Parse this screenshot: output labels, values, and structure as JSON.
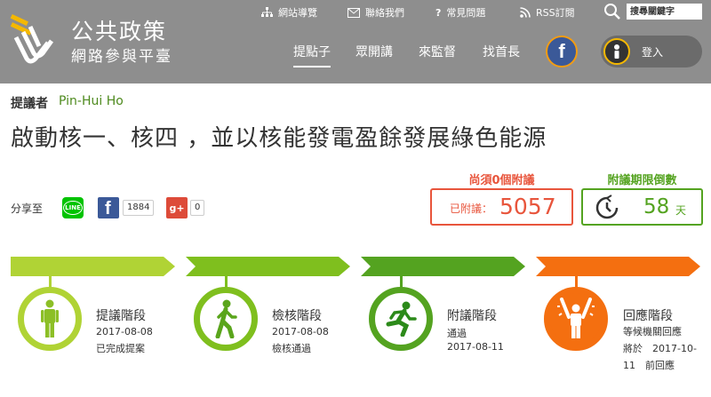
{
  "header": {
    "logo_title": "公共政策",
    "logo_subtitle": "網路參與平臺",
    "util": {
      "sitemap": "網站導覽",
      "contact": "聯絡我們",
      "faq": "常見問題",
      "rss": "RSS訂閱",
      "search_placeholder": "搜尋關鍵字"
    },
    "nav": [
      "提點子",
      "眾開講",
      "來監督",
      "找首長"
    ],
    "login": "登入"
  },
  "proposal": {
    "proposer_label": "提議者",
    "proposer_name": "Pin-Hui Ho",
    "title": "啟動核一、核四 ，並以核能發電盈餘發展綠色能源"
  },
  "share": {
    "label": "分享至",
    "fb_count": "1884",
    "gp_count": "0"
  },
  "stats": {
    "endorse_head": "尚須0個附議",
    "endorse_label": "已附議：",
    "endorse_value": "5057",
    "deadline_head": "附議期限倒數",
    "deadline_value": "58",
    "deadline_unit": "天"
  },
  "colors": {
    "header_bg": "#8e8e8e",
    "green": "#54a320",
    "orange_red": "#e8553c",
    "orange": "#f46f10"
  },
  "stages": [
    {
      "name": "提議階段",
      "lines": [
        "2017-08-08",
        "已完成提案"
      ],
      "icon": "person-standing-icon"
    },
    {
      "name": "檢核階段",
      "lines": [
        "2017-08-08",
        "檢核通過"
      ],
      "icon": "person-walking-icon"
    },
    {
      "name": "附議階段",
      "lines": [
        "通過",
        "2017-08-11"
      ],
      "icon": "person-running-icon"
    },
    {
      "name": "回應階段",
      "lines": [
        "等候機關回應",
        "將於　2017-10-",
        "11　前回應"
      ],
      "icon": "person-cheering-icon"
    }
  ]
}
